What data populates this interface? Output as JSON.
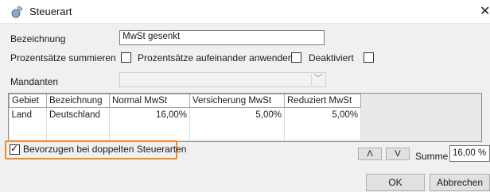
{
  "window": {
    "title": "Steuerart",
    "icon": "tax-wrench-icon",
    "close": "✕"
  },
  "form": {
    "bezeichnung_label": "Bezeichnung",
    "bezeichnung_value": "MwSt gesenkt",
    "prozentsaetze_summieren_label": "Prozentsätze summieren",
    "prozentsaetze_summieren_checked": false,
    "aufeinander_label": "Prozentsätze aufeinander anwenden",
    "aufeinander_checked": false,
    "deaktiviert_label": "Deaktiviert",
    "deaktiviert_checked": false,
    "mandanten_label": "Mandanten",
    "mandanten_value": ""
  },
  "grid": {
    "columns": [
      "Gebiet",
      "Bezeichnung",
      "Normal MwSt",
      "Versicherung MwSt",
      "Reduziert MwSt"
    ],
    "rows": [
      [
        "Land",
        "Deutschland",
        "16,00%",
        "5,00%",
        "5,00%"
      ]
    ]
  },
  "footer": {
    "bevorzugen_label": "Bevorzugen bei doppelten Steuerarten",
    "bevorzugen_checked": true,
    "up_label": "Λ",
    "down_label": "V",
    "summe_label": "Summe",
    "summe_value": "16,00 %",
    "ok_label": "OK",
    "cancel_label": "Abbrechen"
  },
  "colors": {
    "highlight": "#f08a24",
    "window_bg": "#f0f0f0"
  }
}
